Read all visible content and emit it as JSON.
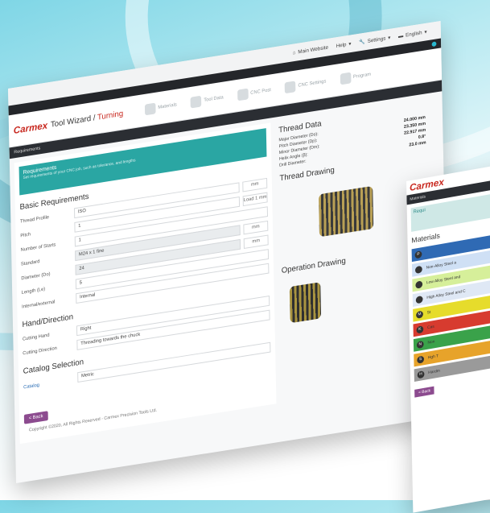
{
  "topnav": {
    "main_website": "Main Website",
    "help": "Help",
    "settings": "Settings",
    "language": "English"
  },
  "brand": {
    "logo": "Carmex",
    "title": "Tool Wizard /",
    "mode": "Turning"
  },
  "steps": [
    "Materials",
    "Tool Data",
    "CNC Post",
    "CNC Settings",
    "Program"
  ],
  "breadcrumb": "Requirements",
  "requirements_card": {
    "title": "Requirements",
    "desc": "Set requirements of your CNC job, such as tolerance, and lengths"
  },
  "basic": {
    "title": "Basic Requirements",
    "rows": [
      {
        "label": "Thread Profile",
        "value": "ISO",
        "unit": "mm"
      },
      {
        "label": "Pitch",
        "value": "1",
        "unit": "Load 1 mm"
      },
      {
        "label": "Number of Starts",
        "value": "1",
        "unit": ""
      },
      {
        "label": "Standard",
        "value": "M24 x 1 fine",
        "unit": "mm"
      },
      {
        "label": "Diameter (Do)",
        "value": "24",
        "unit": "mm"
      },
      {
        "label": "Length (Le)",
        "value": "5",
        "unit": ""
      },
      {
        "label": "Internal/external",
        "value": "Internal",
        "unit": ""
      }
    ]
  },
  "hand": {
    "title": "Hand/Direction",
    "rows": [
      {
        "label": "Cutting Hand",
        "value": "Right"
      },
      {
        "label": "Cutting Direction",
        "value": "Threading towards the chuck"
      }
    ]
  },
  "catalog": {
    "title": "Catalog Selection",
    "link": "Catalog",
    "value": "Metric"
  },
  "back_label": "< Back",
  "footer": "Copyright ©2020, All Rights Reserved - Carmex Precision Tools Ltd.",
  "thread_data": {
    "title": "Thread Data",
    "specs": [
      {
        "label": "Major Diameter (Do):",
        "value": "24.000 mm"
      },
      {
        "label": "Pitch Diameter (Dp):",
        "value": "23.350 mm"
      },
      {
        "label": "Minor Diameter (Dm):",
        "value": "22.917 mm"
      },
      {
        "label": "Helix Angle (β):",
        "value": "0.8°"
      },
      {
        "label": "Drill Diameter:",
        "value": "23.0 mm"
      }
    ]
  },
  "thread_drawing": "Thread Drawing",
  "operation_drawing": "Operation Drawing",
  "window2": {
    "breadcrumb": "Materials",
    "materials_title": "Materials",
    "req_label": "Requi",
    "rows": [
      {
        "code": "P",
        "name": "",
        "color": "#2f6ab4"
      },
      {
        "code": "",
        "name": "Non-Alloy Steel a",
        "color": "#cfe0f5"
      },
      {
        "code": "",
        "name": "Low Alloy Steel and",
        "color": "#d6ef9a"
      },
      {
        "code": "",
        "name": "High Alloy Steel and C",
        "color": "#dfe8f5"
      },
      {
        "code": "M",
        "name": "St",
        "color": "#e6dc2b"
      },
      {
        "code": "K",
        "name": "Cas",
        "color": "#d73b2f"
      },
      {
        "code": "N",
        "name": "Non",
        "color": "#3aa24a"
      },
      {
        "code": "S",
        "name": "Hgh T",
        "color": "#e7a32a"
      },
      {
        "code": "H",
        "name": "Hardm",
        "color": "#9a9a9a"
      }
    ],
    "back_label": "< Back"
  }
}
